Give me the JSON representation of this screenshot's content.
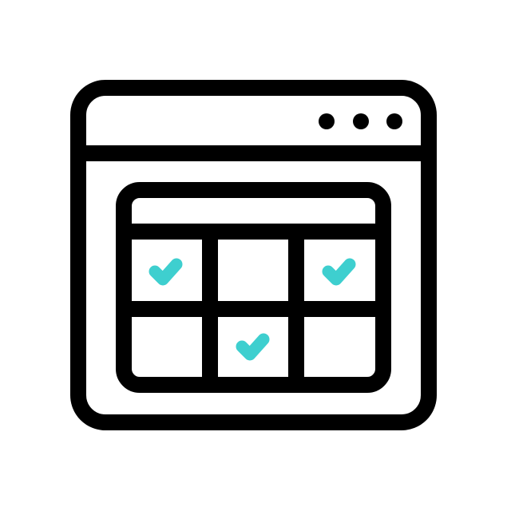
{
  "icon": {
    "name": "browser-calendar-icon",
    "colors": {
      "stroke": "#000000",
      "background": "#ffffff",
      "check": "#3ecfcf"
    },
    "window_dots": 3,
    "calendar": {
      "rows": 2,
      "columns": 3,
      "checked_cells": [
        {
          "row": 0,
          "column": 0
        },
        {
          "row": 0,
          "column": 2
        },
        {
          "row": 1,
          "column": 1
        }
      ]
    }
  }
}
